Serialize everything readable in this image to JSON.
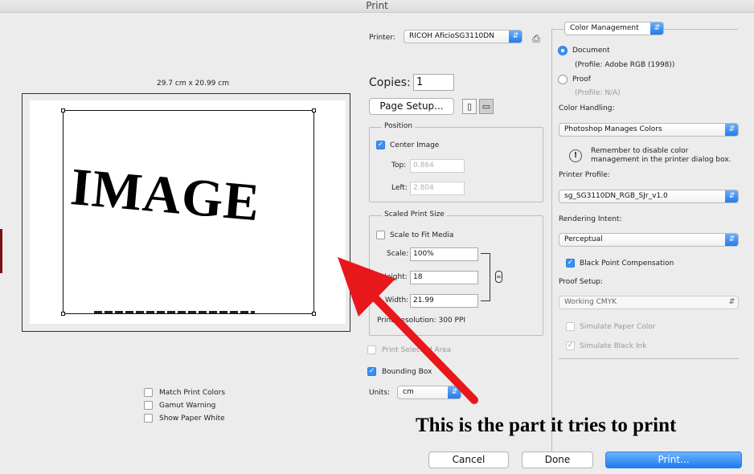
{
  "window": {
    "title": "Print"
  },
  "preview": {
    "paper_size": "29.7 cm x 20.99 cm",
    "image_text": "IMAGE",
    "options": [
      {
        "label": "Match Print Colors",
        "checked": false
      },
      {
        "label": "Gamut Warning",
        "checked": false
      },
      {
        "label": "Show Paper White",
        "checked": false
      }
    ]
  },
  "printer": {
    "label": "Printer:",
    "value": "RICOH AficioSG3110DN"
  },
  "copies": {
    "label": "Copies:",
    "value": "1"
  },
  "page_setup": {
    "label": "Page Setup..."
  },
  "position": {
    "title": "Position",
    "center_image": {
      "label": "Center Image",
      "checked": true
    },
    "top": {
      "label": "Top:",
      "value": "0.864"
    },
    "left": {
      "label": "Left:",
      "value": "2.804"
    }
  },
  "scaled_print_size": {
    "title": "Scaled Print Size",
    "scale_to_fit": {
      "label": "Scale to Fit Media",
      "checked": false
    },
    "scale": {
      "label": "Scale:",
      "value": "100%"
    },
    "height": {
      "label": "Height:",
      "value": "18"
    },
    "width": {
      "label": "Width:",
      "value": "21.99"
    },
    "resolution": "Print Resolution: 300 PPI"
  },
  "print_selected_area": {
    "label": "Print Selected Area",
    "checked": false
  },
  "bounding_box": {
    "label": "Bounding Box",
    "checked": true
  },
  "units": {
    "label": "Units:",
    "value": "cm"
  },
  "color_management": {
    "section": "Color Management",
    "document": {
      "label": "Document",
      "profile": "(Profile: Adobe RGB (1998))",
      "selected": true
    },
    "proof": {
      "label": "Proof",
      "profile": "(Profile: N/A)",
      "selected": false
    },
    "color_handling": {
      "label": "Color Handling:",
      "value": "Photoshop Manages Colors"
    },
    "warning": "Remember to disable color management in the printer dialog box.",
    "printer_profile": {
      "label": "Printer Profile:",
      "value": "sg_SG3110DN_RGB_SJr_v1.0"
    },
    "rendering_intent": {
      "label": "Rendering Intent:",
      "value": "Perceptual"
    },
    "black_point": {
      "label": "Black Point Compensation",
      "checked": true
    },
    "proof_setup": {
      "label": "Proof Setup:",
      "value": "Working CMYK"
    },
    "simulate_paper": {
      "label": "Simulate Paper Color",
      "checked": false
    },
    "simulate_ink": {
      "label": "Simulate Black Ink",
      "checked": true
    }
  },
  "annotation": {
    "text": "This is the part it tries to print",
    "arrow_color": "#e8171b"
  },
  "buttons": {
    "cancel": "Cancel",
    "done": "Done",
    "print": "Print..."
  },
  "colors": {
    "accent": "#1d7cf2",
    "background": "#ececec"
  }
}
